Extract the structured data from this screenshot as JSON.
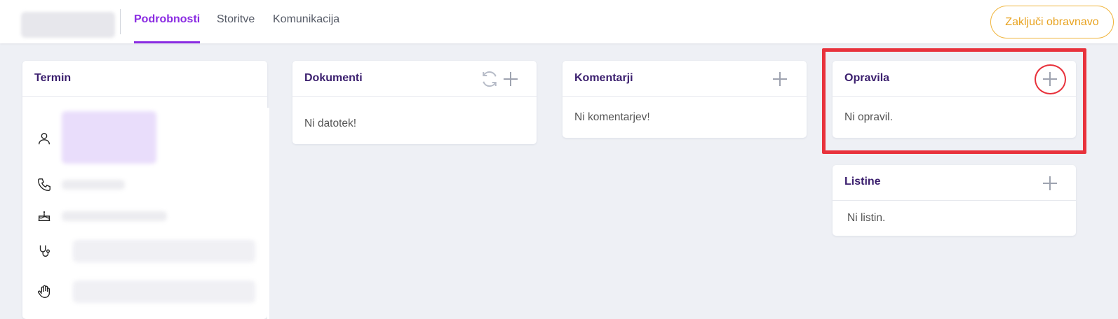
{
  "header": {
    "tabs": [
      {
        "label": "Podrobnosti",
        "active": true
      },
      {
        "label": "Storitve",
        "active": false
      },
      {
        "label": "Komunikacija",
        "active": false
      }
    ],
    "finish_button": "Zaključi obravnavo"
  },
  "cards": {
    "termin": {
      "title": "Termin"
    },
    "dokumenti": {
      "title": "Dokumenti",
      "empty": "Ni datotek!"
    },
    "komentarji": {
      "title": "Komentarji",
      "empty": "Ni komentarjev!"
    },
    "opravila": {
      "title": "Opravila",
      "empty": "Ni opravil."
    },
    "listine": {
      "title": "Listine",
      "empty": "Ni listin."
    }
  },
  "colors": {
    "accent": "#8a2be2",
    "title": "#3b1f6e",
    "warning": "#f0b43a",
    "highlight": "#e8323c"
  },
  "icons": {
    "termin_rows": [
      "user-icon",
      "phone-icon",
      "cake-icon",
      "stethoscope-icon",
      "hand-icon"
    ],
    "card_actions": [
      "refresh-icon",
      "plus-icon"
    ]
  }
}
